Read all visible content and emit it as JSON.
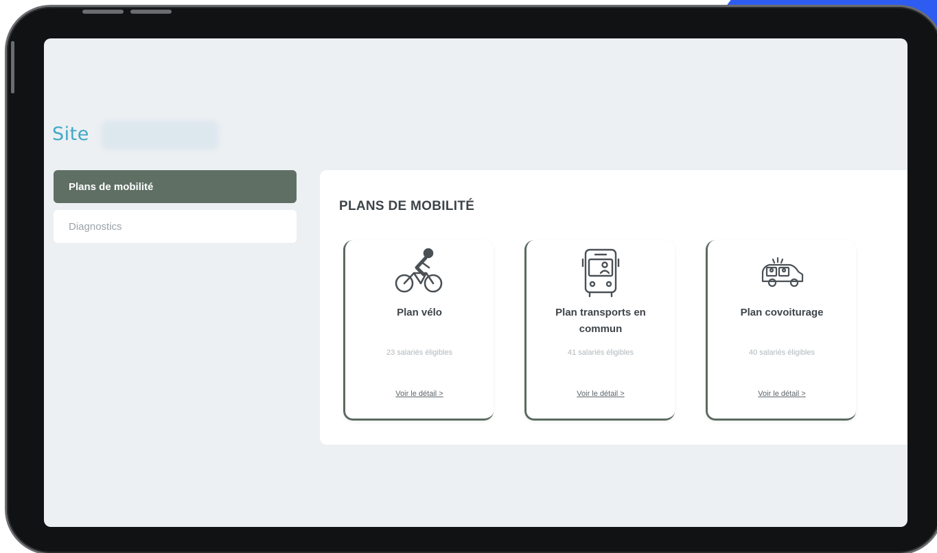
{
  "site": {
    "title": "Site"
  },
  "sidebar": {
    "items": [
      {
        "label": "Plans de mobilité",
        "active": true
      },
      {
        "label": "Diagnostics",
        "active": false
      }
    ]
  },
  "panel": {
    "title": "PLANS DE MOBILITÉ",
    "cards": [
      {
        "icon": "cyclist-icon",
        "title": "Plan vélo",
        "count": "23 salariés éligibles",
        "link": "Voir le détail >"
      },
      {
        "icon": "bus-icon",
        "title": "Plan transports en commun",
        "count": "41 salariés éligibles",
        "link": "Voir le détail >"
      },
      {
        "icon": "carpool-car-icon",
        "title": "Plan covoiturage",
        "count": "40 salariés éligibles",
        "link": "Voir le détail >"
      }
    ]
  },
  "colors": {
    "accent_green": "#5f6f64",
    "site_title": "#41a8c6",
    "background": "#ecf0f3"
  }
}
